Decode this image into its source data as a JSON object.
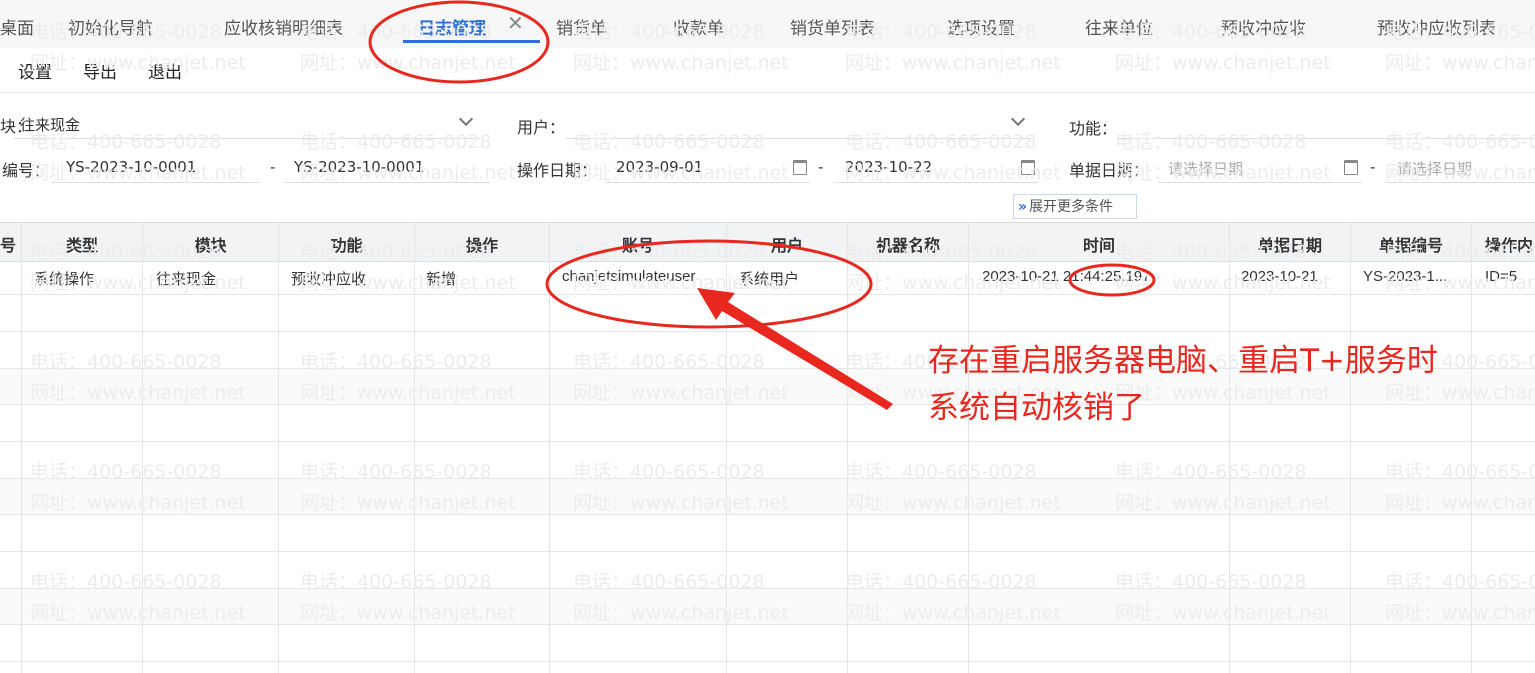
{
  "tabs": [
    {
      "label": "桌面",
      "active": false
    },
    {
      "label": "初始化导航",
      "active": false
    },
    {
      "label": "应收核销明细表",
      "active": false
    },
    {
      "label": "日志管理",
      "active": true
    },
    {
      "label": "销货单",
      "active": false
    },
    {
      "label": "收款单",
      "active": false
    },
    {
      "label": "销货单列表",
      "active": false
    },
    {
      "label": "选项设置",
      "active": false
    },
    {
      "label": "往来单位",
      "active": false
    },
    {
      "label": "预收冲应收",
      "active": false
    },
    {
      "label": "预收冲应收列表",
      "active": false
    }
  ],
  "tab_close_glyph": "✕",
  "toolbar": {
    "settings": "设置",
    "export": "导出",
    "exit": "退出"
  },
  "filters": {
    "module_label": "块：",
    "module_value": "往来现金",
    "user_label": "用户：",
    "user_value": "",
    "function_label": "功能：",
    "function_value": "",
    "docno_label": "编号：",
    "docno_from": "YS-2023-10-0001",
    "docno_to": "YS-2023-10-0001",
    "range_sep": "-",
    "opdate_label": "操作日期：",
    "opdate_from": "2023-09-01",
    "opdate_to": "2023-10-22",
    "docdate_label": "单据日期：",
    "docdate_from_placeholder": "请选择日期",
    "docdate_to_placeholder": "请选择日期",
    "expand": "展开更多条件"
  },
  "grid": {
    "headers": [
      "号",
      "类型",
      "模块",
      "功能",
      "操作",
      "账号",
      "用户",
      "机器名称",
      "时间",
      "单据日期",
      "单据编号",
      "操作内"
    ],
    "rows": [
      [
        "",
        "系统操作",
        "往来现金",
        "预收冲应收",
        "新增",
        "chanjetsimulateuser",
        "系统用户",
        "",
        "2023-10-21 21:44:25.197",
        "2023-10-21",
        "YS-2023-1...",
        "ID=5"
      ]
    ]
  },
  "watermark": {
    "phone": "电话：400-665-0028",
    "site": "网址：www.chanjet.net"
  },
  "annotation": {
    "line1": "存在重启服务器电脑、重启T+服务时",
    "line2": "系统自动核销了",
    "color": "#e8281e"
  },
  "colors": {
    "accent": "#2f6fd6",
    "annotation": "#e8281e"
  }
}
